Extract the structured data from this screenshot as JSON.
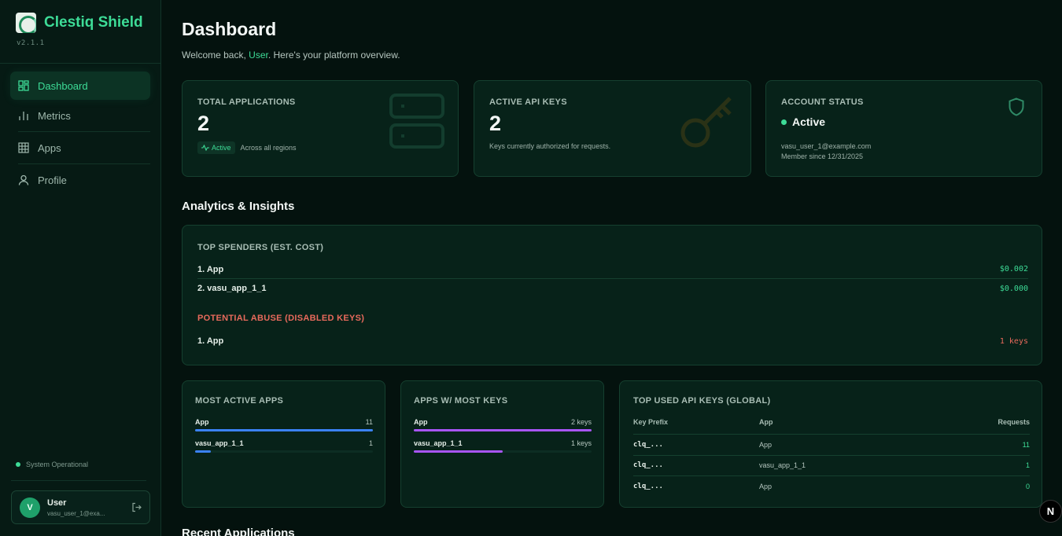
{
  "sidebar": {
    "brand": "Clestiq Shield",
    "version": "v2.1.1",
    "nav": [
      {
        "label": "Dashboard"
      },
      {
        "label": "Metrics"
      },
      {
        "label": "Apps"
      },
      {
        "label": "Profile"
      }
    ],
    "system_status": "System Operational",
    "user": {
      "initial": "V",
      "name": "User",
      "email": "vasu_user_1@exa..."
    }
  },
  "header": {
    "title": "Dashboard",
    "welcome_prefix": "Welcome back, ",
    "welcome_user": "User",
    "welcome_suffix": ". Here's your platform overview."
  },
  "stats": {
    "total_apps": {
      "label": "TOTAL APPLICATIONS",
      "value": "2",
      "badge": "Active",
      "note": "Across all regions"
    },
    "api_keys": {
      "label": "ACTIVE API KEYS",
      "value": "2",
      "note": "Keys currently authorized for requests."
    },
    "account": {
      "label": "ACCOUNT STATUS",
      "status": "Active",
      "email": "vasu_user_1@example.com",
      "since": "Member since 12/31/2025"
    }
  },
  "analytics": {
    "title": "Analytics & Insights",
    "spenders_label": "TOP SPENDERS (EST. COST)",
    "spenders": [
      {
        "name": "1. App",
        "cost": "$0.002"
      },
      {
        "name": "2. vasu_app_1_1",
        "cost": "$0.000"
      }
    ],
    "abuse_label": "POTENTIAL ABUSE (DISABLED KEYS)",
    "abuse": [
      {
        "name": "1. App",
        "count": "1 keys"
      }
    ]
  },
  "most_active": {
    "title": "MOST ACTIVE APPS",
    "items": [
      {
        "name": "App",
        "value": "11",
        "fraction": 1.0
      },
      {
        "name": "vasu_app_1_1",
        "value": "1",
        "fraction": 0.09
      }
    ]
  },
  "most_keys": {
    "title": "APPS W/ MOST KEYS",
    "items": [
      {
        "name": "App",
        "value": "2 keys",
        "fraction": 1.0
      },
      {
        "name": "vasu_app_1_1",
        "value": "1 keys",
        "fraction": 0.5
      }
    ]
  },
  "top_keys": {
    "title": "TOP USED API KEYS (GLOBAL)",
    "headers": {
      "prefix": "Key Prefix",
      "app": "App",
      "requests": "Requests"
    },
    "rows": [
      {
        "prefix": "clq_...",
        "app": "App",
        "requests": "11"
      },
      {
        "prefix": "clq_...",
        "app": "vasu_app_1_1",
        "requests": "1"
      },
      {
        "prefix": "clq_...",
        "app": "App",
        "requests": "0"
      }
    ]
  },
  "recent_title": "Recent Applications",
  "fab": "N",
  "colors": {
    "accent": "#3ddc97",
    "bar_blue": "#3b82f6",
    "bar_purple": "#a855f7",
    "danger": "#e86a5c"
  }
}
